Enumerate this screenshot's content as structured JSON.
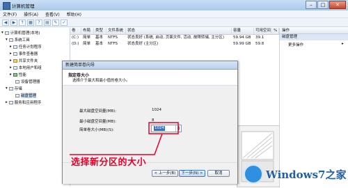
{
  "window": {
    "title": "计算机管理",
    "controls": {
      "minimize": "–",
      "maximize": "□",
      "close": "✕"
    }
  },
  "menu": [
    "文件(F)",
    "操作(A)",
    "查看(V)",
    "帮助(H)"
  ],
  "toolbar": [
    "◀",
    "▶",
    "↑",
    "▦",
    "?",
    "▤",
    "✎",
    "✓"
  ],
  "tree": {
    "items": [
      {
        "label": "计算机管理(本地)",
        "expander": "▾"
      },
      {
        "label": "系统工具",
        "expander": "▾"
      },
      {
        "label": "任务计划程序",
        "expander": "▸"
      },
      {
        "label": "事件查看器",
        "expander": "▸"
      },
      {
        "label": "共享文件夹",
        "expander": "▸"
      },
      {
        "label": "本地用户和组",
        "expander": "▸"
      },
      {
        "label": "性能",
        "expander": "▸"
      },
      {
        "label": "设备管理器",
        "expander": ""
      },
      {
        "label": "存储",
        "expander": "▾"
      },
      {
        "label": "磁盘管理",
        "expander": ""
      },
      {
        "label": "服务和应用程序",
        "expander": "▸"
      }
    ]
  },
  "volumes": {
    "columns": [
      "卷",
      "布局",
      "类型",
      "文件系统",
      "状态",
      "容量",
      "可用空间",
      "%"
    ],
    "rows": [
      [
        "(C:)",
        "简单",
        "基本",
        "NTFS",
        "状态良好 (系统, 启动, 页面文件, 活动, 故障转储, 主分区)",
        "59.94 GB",
        "39.1",
        ""
      ],
      [
        "(D:)",
        "简单",
        "基本",
        "NTFS",
        "状态良好 (主分区)",
        "59.99 GB",
        "59.8",
        ""
      ]
    ]
  },
  "actions": {
    "header": "操作",
    "section": "磁盘管理",
    "more": "更多操作"
  },
  "dialog": {
    "title": "新建简单卷向导",
    "heading": "指定卷大小",
    "subheading": "选择介于最大和最小值的卷大小。",
    "max_label": "最大磁盘空间量(MB):",
    "max_value": "1024",
    "min_label": "最小磁盘空间量(MB):",
    "min_value": "8",
    "size_label": "简单卷大小(MB)(S):",
    "size_value": "1024",
    "back": "< 上一步(B)",
    "next": "下一步(N) >",
    "cancel": "取消"
  },
  "annotation": {
    "text": "选择新分区的大小",
    "color": "#e5002b"
  },
  "watermark": {
    "text": "Windows7之家"
  }
}
